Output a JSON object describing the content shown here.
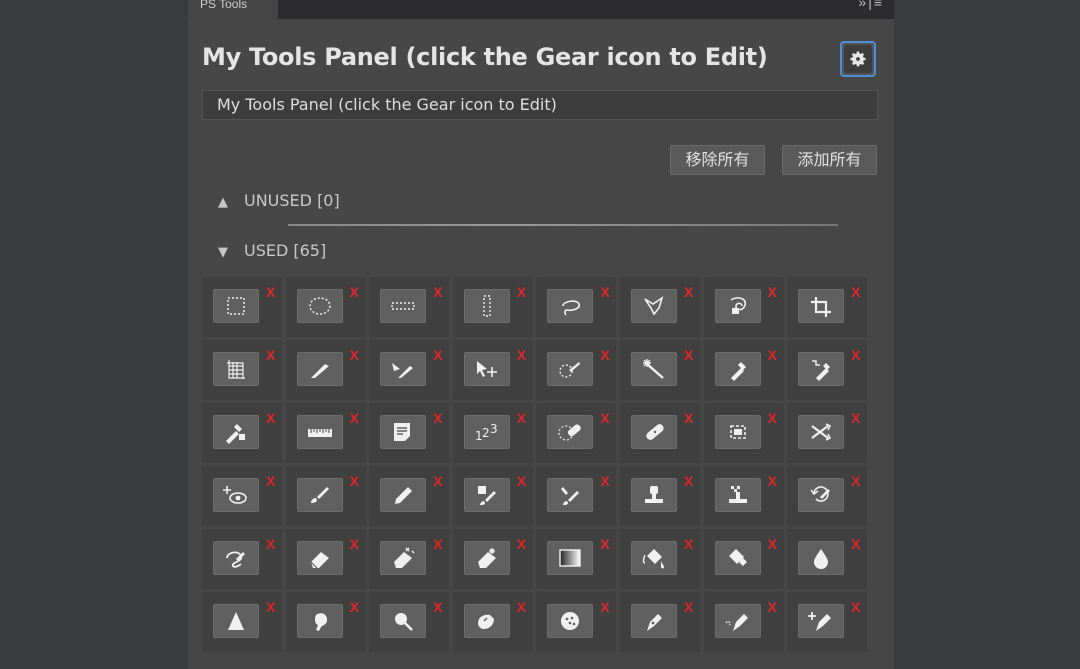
{
  "tab": {
    "label": "PS Tools"
  },
  "panel": {
    "title": "My Tools Panel (click the Gear icon to Edit)",
    "name_field": "My Tools Panel (click the Gear icon to Edit)",
    "remove_all_label": "移除所有",
    "add_all_label": "添加所有",
    "unused": {
      "arrow": "▲",
      "label": "UNUSED [0]"
    },
    "used": {
      "arrow": "▼",
      "label": "USED [65]"
    },
    "remove_mark": "X"
  },
  "tools": [
    "rect-marquee",
    "ellipse-marquee",
    "single-row-marquee",
    "single-column-marquee",
    "lasso",
    "polygonal-lasso",
    "magnetic-lasso",
    "crop",
    "perspective-crop",
    "slice",
    "slice-select",
    "move",
    "quick-selection",
    "magic-wand",
    "eyedropper",
    "color-sampler",
    "3d-material-eyedropper",
    "ruler",
    "note",
    "count",
    "spot-healing-brush",
    "healing-brush",
    "patch",
    "content-aware-move",
    "red-eye",
    "brush",
    "pencil",
    "color-replacement",
    "mixer-brush",
    "clone-stamp",
    "pattern-stamp",
    "history-brush",
    "art-history-brush",
    "eraser",
    "background-eraser",
    "magic-eraser",
    "gradient",
    "paint-bucket",
    "3d-material-drop",
    "blur",
    "sharpen",
    "smudge",
    "dodge",
    "burn",
    "sponge",
    "pen",
    "freeform-pen",
    "add-anchor-point"
  ],
  "colors": {
    "accent": "#4e8fd8",
    "remove": "#e0262a",
    "panel": "#474747",
    "background": "#3a3b3e"
  }
}
